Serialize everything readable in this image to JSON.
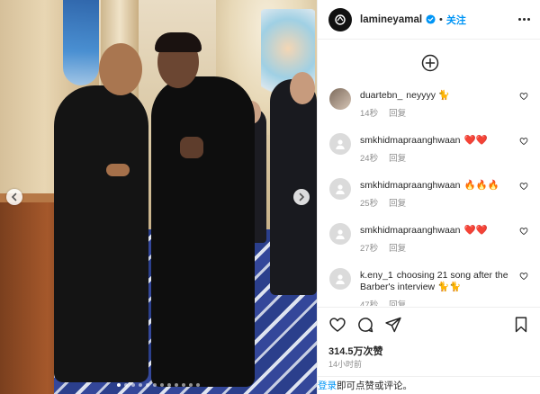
{
  "post": {
    "username": "lamineyamal",
    "separator": "•",
    "follow_label": "关注",
    "likes": "314.5万次赞",
    "time_ago": "14小时前",
    "login_link": "登录",
    "login_rest": "即可点赞或评论。",
    "carousel_total": 12,
    "carousel_active_index": 0
  },
  "comments": [
    {
      "user": "duartebn_",
      "text": "neyyyy 🐈",
      "time": "14秒",
      "reply": "回复",
      "avatar": "photo"
    },
    {
      "user": "smkhidmapraanghwaan",
      "text": "❤️❤️",
      "time": "24秒",
      "reply": "回复",
      "avatar": "default"
    },
    {
      "user": "smkhidmapraanghwaan",
      "text": "🔥🔥🔥",
      "time": "25秒",
      "reply": "回复",
      "avatar": "default"
    },
    {
      "user": "smkhidmapraanghwaan",
      "text": "❤️❤️",
      "time": "27秒",
      "reply": "回复",
      "avatar": "default"
    },
    {
      "user": "k.eny_1",
      "text": "choosing 21 song after the Barber's interview 🐈🐈",
      "time": "47秒",
      "reply": "回复",
      "avatar": "default"
    }
  ],
  "icons": {
    "verified": "verified-badge-icon",
    "more": "more-options-icon",
    "add_comment": "add-circle-icon",
    "like": "heart-icon",
    "comment": "comment-icon",
    "share": "share-icon",
    "save": "bookmark-icon",
    "prev": "chevron-left-icon",
    "next": "chevron-right-icon"
  },
  "colors": {
    "accent": "#0095f6",
    "text": "#262626",
    "muted": "#8e8e8e"
  }
}
